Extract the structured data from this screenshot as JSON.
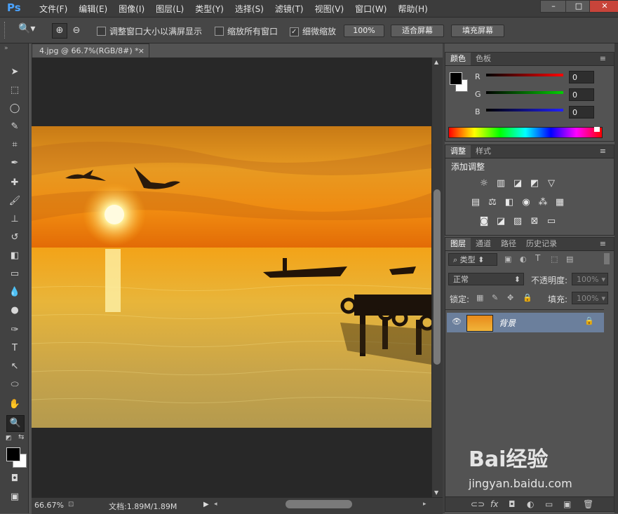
{
  "app": {
    "logo": "Ps"
  },
  "menu": [
    "文件(F)",
    "编辑(E)",
    "图像(I)",
    "图层(L)",
    "类型(Y)",
    "选择(S)",
    "滤镜(T)",
    "视图(V)",
    "窗口(W)",
    "帮助(H)"
  ],
  "window_controls": {
    "minimize": "–",
    "maximize": "□",
    "close": "✕"
  },
  "options": {
    "resize_windows_label": "调整窗口大小以满屏显示",
    "resize_windows_checked": false,
    "zoom_all_label": "缩放所有窗口",
    "zoom_all_checked": false,
    "scrubby_zoom_label": "细微缩放",
    "scrubby_zoom_checked": true,
    "btn_100": "100%",
    "btn_fit": "适合屏幕",
    "btn_fill": "填充屏幕"
  },
  "document": {
    "tab_title": "4.jpg @ 66.7%(RGB/8#) *",
    "tab_close": "×",
    "zoom": "66.67%",
    "doc_size": "文档:1.89M/1.89M"
  },
  "color_panel": {
    "tabs": [
      "颜色",
      "色板"
    ],
    "active_tab": 0,
    "channels": [
      {
        "label": "R",
        "value": "0",
        "color": "#ff2020"
      },
      {
        "label": "G",
        "value": "0",
        "color": "#20d020"
      },
      {
        "label": "B",
        "value": "0",
        "color": "#2040ff"
      }
    ]
  },
  "adjustments_panel": {
    "tabs": [
      "调整",
      "样式"
    ],
    "active_tab": 0,
    "heading": "添加调整"
  },
  "layers_panel": {
    "tabs": [
      "图层",
      "通道",
      "路径",
      "历史记录"
    ],
    "active_tab": 0,
    "filter_kind": "类型",
    "blend_mode": "正常",
    "opacity_label": "不透明度:",
    "opacity_value": "100%",
    "lock_label": "锁定:",
    "fill_label": "填充:",
    "fill_value": "100%",
    "layers": [
      {
        "name": "背景",
        "visible": true,
        "locked": true
      }
    ]
  },
  "watermark": {
    "brand": "Bai经验",
    "url": "jingyan.baidu.com"
  }
}
